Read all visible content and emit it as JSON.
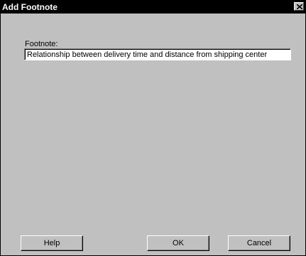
{
  "window": {
    "title": "Add Footnote",
    "close_icon": "close-icon"
  },
  "form": {
    "footnote_label": "Footnote:",
    "footnote_value": "Relationship between delivery time and distance from shipping center"
  },
  "buttons": {
    "help": "Help",
    "ok": "OK",
    "cancel": "Cancel"
  }
}
